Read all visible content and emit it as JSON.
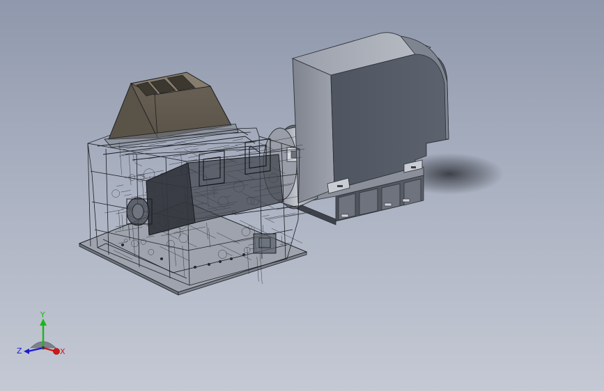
{
  "viewport": {
    "model": "crusher-motor-assembly"
  },
  "triad": {
    "x_label": "X",
    "y_label": "Y",
    "z_label": "Z",
    "colors": {
      "x": "#d01818",
      "y": "#18b818",
      "z": "#1c1ccc"
    }
  },
  "colors": {
    "motor_body": "#6c727e",
    "motor_light": "#a2a7b1",
    "hopper": "#6d6458",
    "wireframe": "#1b1d22"
  }
}
